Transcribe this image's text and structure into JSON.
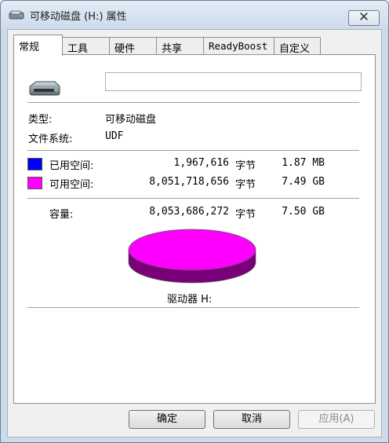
{
  "window": {
    "title": "可移动磁盘 (H:) 属性",
    "close_label": "✕"
  },
  "tabs": [
    {
      "label": "常规"
    },
    {
      "label": "工具"
    },
    {
      "label": "硬件"
    },
    {
      "label": "共享"
    },
    {
      "label": "ReadyBoost"
    },
    {
      "label": "自定义"
    }
  ],
  "general": {
    "name_value": "",
    "type_label": "类型:",
    "type_value": "可移动磁盘",
    "fs_label": "文件系统:",
    "fs_value": "UDF",
    "used": {
      "label": "已用空间:",
      "bytes": "1,967,616",
      "unit": "字节",
      "human": "1.87 MB",
      "color": "#0000ff"
    },
    "free": {
      "label": "可用空间:",
      "bytes": "8,051,718,656",
      "unit": "字节",
      "human": "7.49 GB",
      "color": "#ff00ff"
    },
    "capacity": {
      "label": "容量:",
      "bytes": "8,053,686,272",
      "unit": "字节",
      "human": "7.50 GB"
    },
    "drive_label": "驱动器 H:",
    "used_fraction": 0.000244
  },
  "buttons": {
    "ok": "确定",
    "cancel": "取消",
    "apply": "应用(A)"
  },
  "icons": {
    "title": "removable-drive-icon",
    "drive": "removable-drive-icon"
  }
}
